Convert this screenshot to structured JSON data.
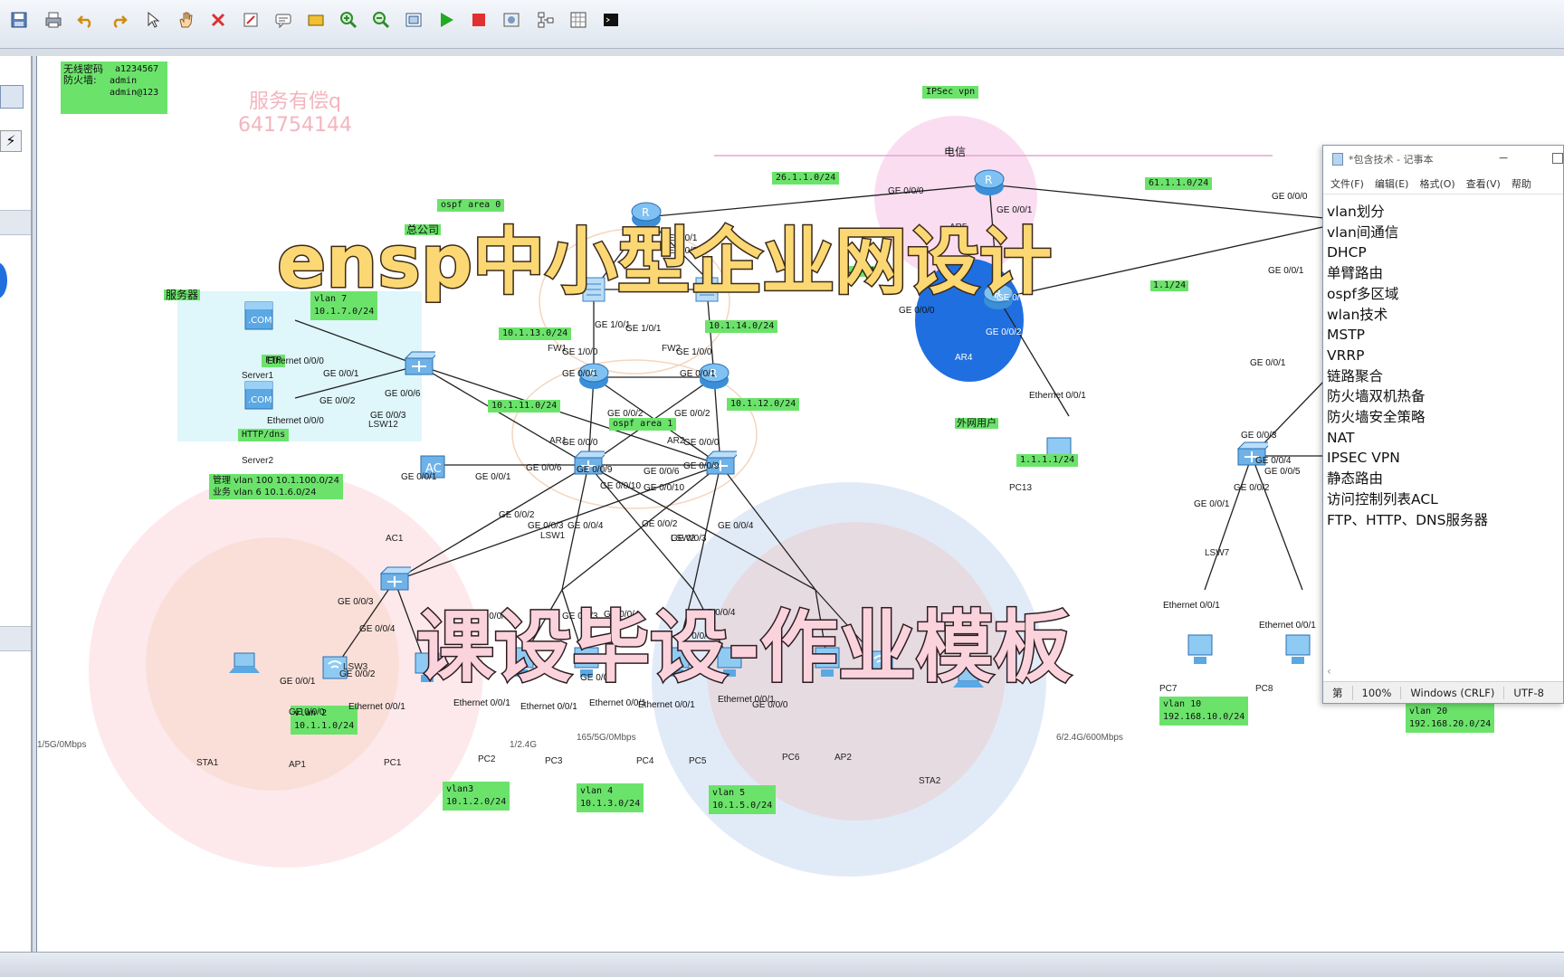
{
  "toolbar": {
    "icons": [
      "save-icon",
      "print-icon",
      "undo-icon",
      "redo-icon",
      "pointer-icon",
      "hand-icon",
      "delete-icon",
      "erase-icon",
      "text-icon",
      "rect-icon",
      "zoom-in-icon",
      "zoom-out-icon",
      "fit-icon",
      "start-icon",
      "stop-icon",
      "capture-icon",
      "topo-icon",
      "grid-icon",
      "console-icon"
    ]
  },
  "overlay": {
    "title": "ensp中小型企业网设计",
    "subtitle": "课设毕设-作业模板",
    "watermark_line1": "服务有偿q",
    "watermark_line2": "641754144"
  },
  "notes": {
    "label1": "无线密码",
    "label2": "防火墙:",
    "values": [
      "a1234567",
      "admin",
      "admin@123"
    ]
  },
  "areas": {
    "ipsec": "IPSec vpn",
    "telecom": "电信",
    "hq": "总公司",
    "ospf0": "ospf area 0",
    "ospf1": "ospf area 1",
    "servers": "服务器",
    "external": "外网用户"
  },
  "subnets": {
    "s26": "26.1.1.0/24",
    "s61": "61.1.1.0/24",
    "s13": "10.1.13.0/24",
    "s14": "10.1.14.0/24",
    "s11": "10.1.11.0/24",
    "s12": "10.1.12.0/24",
    "s1_1": "1.1.1.1/24",
    "vlan7a": "vlan 7",
    "vlan7b": "10.1.7.0/24",
    "ftp": "FTP",
    "httpdns": "HTTP/dns",
    "mgmt1": "管理 vlan 100 10.1.100.0/24",
    "mgmt2": "业务 vlan 6 10.1.6.0/24",
    "vlan2a": "vlan 2",
    "vlan2b": "10.1.1.0/24",
    "vlan3a": "vlan3",
    "vlan3b": "10.1.2.0/24",
    "vlan4a": "vlan 4",
    "vlan4b": "10.1.3.0/24",
    "vlan5a": "vlan 5",
    "vlan5b": "10.1.5.0/24",
    "vlan10a": "vlan 10",
    "vlan10b": "192.168.10.0/24",
    "vlan20a": "vlan 20",
    "vlan20b": "192.168.20.0/24",
    "wifi1": "1/5G/0Mbps",
    "wifi2": "1/2.4G",
    "wifi3": "165/5G/0Mbps",
    "wifi4": "6/2.4G/600Mbps",
    "frag1": "1.0/24",
    "frag2": "1.1/24"
  },
  "devices": {
    "server1": "Server1",
    "server2": "Server2",
    "lsw12": "LSW12",
    "ac1": "AC1",
    "fw1": "FW1",
    "fw2": "FW2",
    "ar1": "AR1",
    "ar2": "AR2",
    "ar4": "AR4",
    "ar5": "AR5",
    "lsw1": "LSW1",
    "lsw2": "LSW2",
    "lsw3": "LSW3",
    "lsw7": "LSW7",
    "sta1": "STA1",
    "ap1": "AP1",
    "pc1": "PC1",
    "pc2": "PC2",
    "pc3": "PC3",
    "pc4": "PC4",
    "pc5": "PC5",
    "pc6": "PC6",
    "ap2": "AP2",
    "sta2": "STA2",
    "pc7": "PC7",
    "pc8": "PC8",
    "pc13": "PC13",
    "com": ".COM"
  },
  "ports": {
    "ge000": "GE 0/0/0",
    "ge001": "GE 0/0/1",
    "ge002": "GE 0/0/2",
    "ge003": "GE 0/0/3",
    "ge004": "GE 0/0/4",
    "ge005": "GE 0/0/5",
    "ge006": "GE 0/0/6",
    "ge009": "GE 0/0/9",
    "ge0010": "GE 0/0/10",
    "ge201": "GE 2/0/1",
    "ge202": "GE 2/0/2",
    "ge100": "GE 1/0/0",
    "ge101": "GE 1/0/1",
    "eth000": "Ethernet 0/0/0",
    "eth001": "Ethernet 0/0/1"
  },
  "notepad": {
    "title": "*包含技术 - 记事本",
    "menu": [
      "文件(F)",
      "编辑(E)",
      "格式(O)",
      "查看(V)",
      "帮助"
    ],
    "lines": [
      "vlan划分",
      "vlan间通信",
      "DHCP",
      "单臂路由",
      "ospf多区域",
      "wlan技术",
      "MSTP",
      "VRRP",
      "链路聚合",
      "防火墙双机热备",
      "防火墙安全策略",
      "NAT",
      "IPSEC VPN",
      "静态路由",
      "访问控制列表ACL",
      "FTP、HTTP、DNS服务器"
    ],
    "status_line": "第",
    "zoom": "100%",
    "eol": "Windows (CRLF)",
    "encoding": "UTF-8"
  },
  "colors": {
    "label_green": "#6be36b",
    "title_yellow": "#fbd874",
    "title_pink": "#fbd3dc",
    "ar4_blue": "#1f6fe0"
  }
}
